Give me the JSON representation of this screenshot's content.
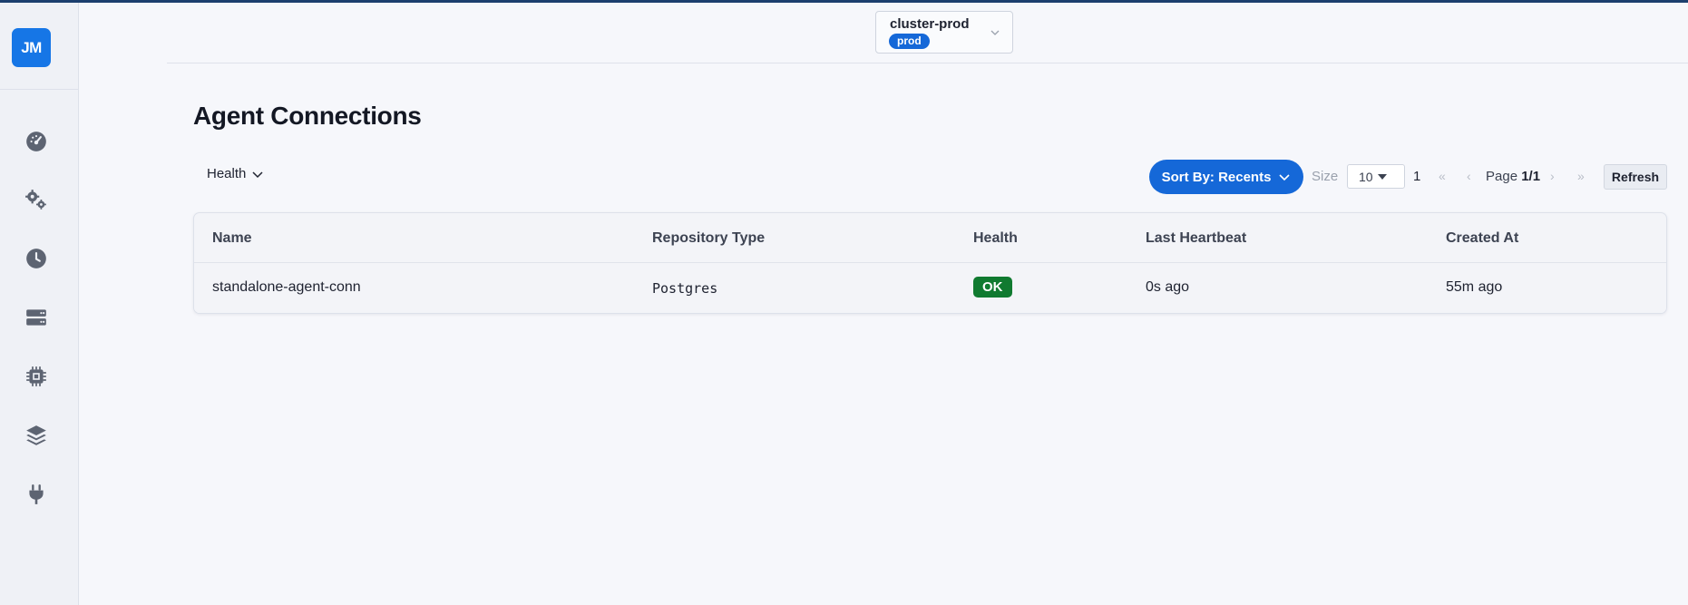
{
  "sidebar": {
    "logo": "JM",
    "items": [
      {
        "icon": "dashboard-gauge-icon"
      },
      {
        "icon": "gears-icon"
      },
      {
        "icon": "clock-icon"
      },
      {
        "icon": "server-icon"
      },
      {
        "icon": "cpu-chip-icon"
      },
      {
        "icon": "layers-icon"
      },
      {
        "icon": "plug-icon"
      }
    ]
  },
  "header": {
    "cluster_name": "cluster-prod",
    "cluster_env": "prod"
  },
  "page": {
    "title": "Agent Connections"
  },
  "toolbar": {
    "health_filter": "Health",
    "sort_label": "Sort By: Recents",
    "size_label": "Size",
    "size_value": "10",
    "page_number": "1",
    "first_page": "«",
    "prev_page": "‹",
    "page_prefix": "Page",
    "page_value": "1/1",
    "next_page": "›",
    "last_page": "»",
    "refresh_label": "Refresh"
  },
  "table": {
    "columns": [
      "Name",
      "Repository Type",
      "Health",
      "Last Heartbeat",
      "Created At"
    ],
    "rows": [
      {
        "name": "standalone-agent-conn",
        "repository_type": "Postgres",
        "health": "OK",
        "last_heartbeat": "0s ago",
        "created_at": "55m ago"
      }
    ]
  },
  "colors": {
    "accent": "#1568d8",
    "ok": "#107a30",
    "sidebar_bg": "#eff1f6",
    "top_bar": "#1c3f6e"
  }
}
